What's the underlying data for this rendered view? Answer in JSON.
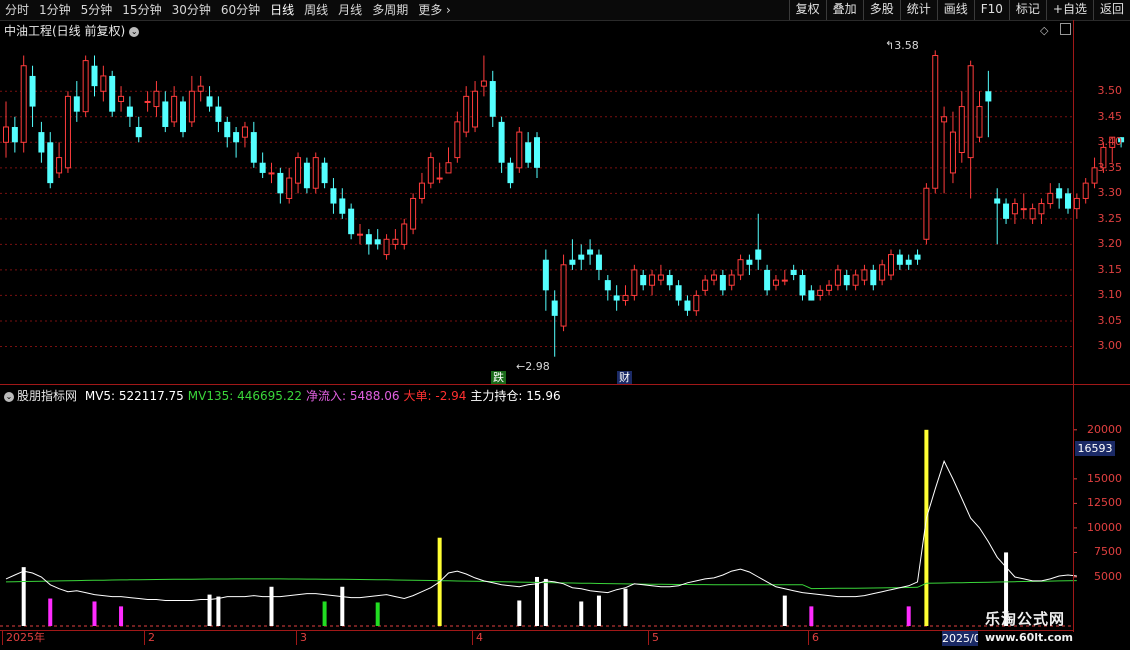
{
  "toolbar": {
    "period_tabs": [
      "分时",
      "1分钟",
      "5分钟",
      "15分钟",
      "30分钟",
      "60分钟",
      "日线",
      "周线",
      "月线",
      "多周期",
      "更多"
    ],
    "active_tab": "日线",
    "right_tools": [
      "复权",
      "叠加",
      "多股",
      "统计",
      "画线",
      "F10",
      "标记",
      "+自选",
      "返回"
    ]
  },
  "main_chart": {
    "title": "中油工程(日线 前复权)",
    "high_label": "3.58",
    "low_label": "2.98",
    "markers": {
      "die": "跌",
      "cai": "财"
    },
    "price_axis": [
      "3.50",
      "3.45",
      "3.40",
      "3.35",
      "3.30",
      "3.25",
      "3.20",
      "3.15",
      "3.10",
      "3.05",
      "3.00"
    ]
  },
  "indicator": {
    "name": "股朋指标网",
    "fields": [
      {
        "label": "MV5",
        "value": "522117.75",
        "color": "#ffffff"
      },
      {
        "label": "MV135",
        "value": "446695.22",
        "color": "#3ad53a"
      },
      {
        "label": "净流入",
        "value": "5488.06",
        "color": "#e060e0"
      },
      {
        "label": "大单",
        "value": "-2.94",
        "color": "#ff3030"
      },
      {
        "label": "主力持仓",
        "value": "15.96",
        "color": "#ffffff"
      }
    ],
    "axis": [
      "20000",
      "15000",
      "12500",
      "10000",
      "7500",
      "5000"
    ],
    "current_value": "16593"
  },
  "time_axis": {
    "labels": [
      "2025年",
      "2",
      "3",
      "4",
      "5",
      "6"
    ],
    "current_date": "2025/0"
  },
  "watermark": {
    "title": "乐淘公式网",
    "url": "www.60lt.com"
  },
  "colors": {
    "up": "#ff3c3c",
    "down": "#54ffff",
    "axis": "#e04040",
    "grid": "#7a1010"
  },
  "chart_data": {
    "type": "candlestick",
    "price_range": [
      2.95,
      3.62
    ],
    "candles": [
      {
        "o": 3.4,
        "c": 3.43,
        "h": 3.48,
        "l": 3.37
      },
      {
        "o": 3.43,
        "c": 3.4,
        "h": 3.45,
        "l": 3.38
      },
      {
        "o": 3.4,
        "c": 3.55,
        "h": 3.57,
        "l": 3.38
      },
      {
        "o": 3.53,
        "c": 3.47,
        "h": 3.55,
        "l": 3.43
      },
      {
        "o": 3.42,
        "c": 3.38,
        "h": 3.44,
        "l": 3.36
      },
      {
        "o": 3.4,
        "c": 3.32,
        "h": 3.42,
        "l": 3.31
      },
      {
        "o": 3.34,
        "c": 3.37,
        "h": 3.4,
        "l": 3.33
      },
      {
        "o": 3.35,
        "c": 3.49,
        "h": 3.5,
        "l": 3.34
      },
      {
        "o": 3.49,
        "c": 3.46,
        "h": 3.52,
        "l": 3.44
      },
      {
        "o": 3.46,
        "c": 3.56,
        "h": 3.57,
        "l": 3.45
      },
      {
        "o": 3.55,
        "c": 3.51,
        "h": 3.57,
        "l": 3.49
      },
      {
        "o": 3.5,
        "c": 3.53,
        "h": 3.55,
        "l": 3.48
      },
      {
        "o": 3.53,
        "c": 3.46,
        "h": 3.54,
        "l": 3.45
      },
      {
        "o": 3.48,
        "c": 3.49,
        "h": 3.51,
        "l": 3.46
      },
      {
        "o": 3.47,
        "c": 3.45,
        "h": 3.49,
        "l": 3.43
      },
      {
        "o": 3.43,
        "c": 3.41,
        "h": 3.45,
        "l": 3.4
      },
      {
        "o": 3.48,
        "c": 3.48,
        "h": 3.5,
        "l": 3.46
      },
      {
        "o": 3.47,
        "c": 3.5,
        "h": 3.52,
        "l": 3.45
      },
      {
        "o": 3.48,
        "c": 3.43,
        "h": 3.5,
        "l": 3.42
      },
      {
        "o": 3.44,
        "c": 3.49,
        "h": 3.51,
        "l": 3.43
      },
      {
        "o": 3.48,
        "c": 3.42,
        "h": 3.49,
        "l": 3.41
      },
      {
        "o": 3.44,
        "c": 3.5,
        "h": 3.53,
        "l": 3.43
      },
      {
        "o": 3.5,
        "c": 3.51,
        "h": 3.53,
        "l": 3.48
      },
      {
        "o": 3.49,
        "c": 3.47,
        "h": 3.51,
        "l": 3.46
      },
      {
        "o": 3.47,
        "c": 3.44,
        "h": 3.49,
        "l": 3.42
      },
      {
        "o": 3.44,
        "c": 3.41,
        "h": 3.45,
        "l": 3.39
      },
      {
        "o": 3.42,
        "c": 3.4,
        "h": 3.43,
        "l": 3.37
      },
      {
        "o": 3.41,
        "c": 3.43,
        "h": 3.44,
        "l": 3.39
      },
      {
        "o": 3.42,
        "c": 3.36,
        "h": 3.44,
        "l": 3.35
      },
      {
        "o": 3.36,
        "c": 3.34,
        "h": 3.38,
        "l": 3.33
      },
      {
        "o": 3.34,
        "c": 3.34,
        "h": 3.36,
        "l": 3.32
      },
      {
        "o": 3.34,
        "c": 3.3,
        "h": 3.35,
        "l": 3.28
      },
      {
        "o": 3.29,
        "c": 3.33,
        "h": 3.35,
        "l": 3.28
      },
      {
        "o": 3.32,
        "c": 3.37,
        "h": 3.38,
        "l": 3.3
      },
      {
        "o": 3.36,
        "c": 3.31,
        "h": 3.37,
        "l": 3.3
      },
      {
        "o": 3.31,
        "c": 3.37,
        "h": 3.38,
        "l": 3.3
      },
      {
        "o": 3.36,
        "c": 3.32,
        "h": 3.37,
        "l": 3.31
      },
      {
        "o": 3.31,
        "c": 3.28,
        "h": 3.33,
        "l": 3.26
      },
      {
        "o": 3.29,
        "c": 3.26,
        "h": 3.31,
        "l": 3.25
      },
      {
        "o": 3.27,
        "c": 3.22,
        "h": 3.28,
        "l": 3.21
      },
      {
        "o": 3.22,
        "c": 3.22,
        "h": 3.24,
        "l": 3.2
      },
      {
        "o": 3.22,
        "c": 3.2,
        "h": 3.23,
        "l": 3.18
      },
      {
        "o": 3.21,
        "c": 3.2,
        "h": 3.23,
        "l": 3.19
      },
      {
        "o": 3.18,
        "c": 3.21,
        "h": 3.22,
        "l": 3.17
      },
      {
        "o": 3.2,
        "c": 3.21,
        "h": 3.23,
        "l": 3.19
      },
      {
        "o": 3.2,
        "c": 3.24,
        "h": 3.25,
        "l": 3.19
      },
      {
        "o": 3.23,
        "c": 3.29,
        "h": 3.3,
        "l": 3.22
      },
      {
        "o": 3.29,
        "c": 3.32,
        "h": 3.34,
        "l": 3.28
      },
      {
        "o": 3.32,
        "c": 3.37,
        "h": 3.38,
        "l": 3.31
      },
      {
        "o": 3.33,
        "c": 3.33,
        "h": 3.36,
        "l": 3.32
      },
      {
        "o": 3.34,
        "c": 3.36,
        "h": 3.39,
        "l": 3.34
      },
      {
        "o": 3.37,
        "c": 3.44,
        "h": 3.46,
        "l": 3.36
      },
      {
        "o": 3.42,
        "c": 3.49,
        "h": 3.51,
        "l": 3.41
      },
      {
        "o": 3.43,
        "c": 3.5,
        "h": 3.52,
        "l": 3.42
      },
      {
        "o": 3.51,
        "c": 3.52,
        "h": 3.57,
        "l": 3.49
      },
      {
        "o": 3.52,
        "c": 3.45,
        "h": 3.54,
        "l": 3.43
      },
      {
        "o": 3.44,
        "c": 3.36,
        "h": 3.45,
        "l": 3.34
      },
      {
        "o": 3.36,
        "c": 3.32,
        "h": 3.37,
        "l": 3.31
      },
      {
        "o": 3.35,
        "c": 3.42,
        "h": 3.43,
        "l": 3.34
      },
      {
        "o": 3.4,
        "c": 3.36,
        "h": 3.42,
        "l": 3.35
      },
      {
        "o": 3.41,
        "c": 3.35,
        "h": 3.42,
        "l": 3.33
      },
      {
        "o": 3.17,
        "c": 3.11,
        "h": 3.19,
        "l": 3.07
      },
      {
        "o": 3.09,
        "c": 3.06,
        "h": 3.11,
        "l": 2.98
      },
      {
        "o": 3.04,
        "c": 3.16,
        "h": 3.18,
        "l": 3.03
      },
      {
        "o": 3.17,
        "c": 3.16,
        "h": 3.21,
        "l": 3.15
      },
      {
        "o": 3.18,
        "c": 3.17,
        "h": 3.2,
        "l": 3.15
      },
      {
        "o": 3.19,
        "c": 3.18,
        "h": 3.21,
        "l": 3.16
      },
      {
        "o": 3.18,
        "c": 3.15,
        "h": 3.19,
        "l": 3.13
      },
      {
        "o": 3.13,
        "c": 3.11,
        "h": 3.14,
        "l": 3.09
      },
      {
        "o": 3.1,
        "c": 3.09,
        "h": 3.12,
        "l": 3.07
      },
      {
        "o": 3.09,
        "c": 3.1,
        "h": 3.12,
        "l": 3.08
      },
      {
        "o": 3.1,
        "c": 3.15,
        "h": 3.16,
        "l": 3.09
      },
      {
        "o": 3.14,
        "c": 3.12,
        "h": 3.15,
        "l": 3.11
      },
      {
        "o": 3.12,
        "c": 3.14,
        "h": 3.15,
        "l": 3.1
      },
      {
        "o": 3.13,
        "c": 3.14,
        "h": 3.16,
        "l": 3.12
      },
      {
        "o": 3.14,
        "c": 3.12,
        "h": 3.15,
        "l": 3.11
      },
      {
        "o": 3.12,
        "c": 3.09,
        "h": 3.13,
        "l": 3.08
      },
      {
        "o": 3.09,
        "c": 3.07,
        "h": 3.1,
        "l": 3.06
      },
      {
        "o": 3.07,
        "c": 3.1,
        "h": 3.11,
        "l": 3.06
      },
      {
        "o": 3.11,
        "c": 3.13,
        "h": 3.14,
        "l": 3.1
      },
      {
        "o": 3.13,
        "c": 3.14,
        "h": 3.15,
        "l": 3.12
      },
      {
        "o": 3.14,
        "c": 3.11,
        "h": 3.15,
        "l": 3.1
      },
      {
        "o": 3.12,
        "c": 3.14,
        "h": 3.15,
        "l": 3.11
      },
      {
        "o": 3.14,
        "c": 3.17,
        "h": 3.18,
        "l": 3.13
      },
      {
        "o": 3.17,
        "c": 3.16,
        "h": 3.18,
        "l": 3.14
      },
      {
        "o": 3.19,
        "c": 3.17,
        "h": 3.26,
        "l": 3.15
      },
      {
        "o": 3.15,
        "c": 3.11,
        "h": 3.16,
        "l": 3.1
      },
      {
        "o": 3.12,
        "c": 3.13,
        "h": 3.14,
        "l": 3.11
      },
      {
        "o": 3.13,
        "c": 3.13,
        "h": 3.15,
        "l": 3.12
      },
      {
        "o": 3.15,
        "c": 3.14,
        "h": 3.16,
        "l": 3.13
      },
      {
        "o": 3.14,
        "c": 3.1,
        "h": 3.15,
        "l": 3.09
      },
      {
        "o": 3.11,
        "c": 3.09,
        "h": 3.12,
        "l": 3.09
      },
      {
        "o": 3.1,
        "c": 3.11,
        "h": 3.12,
        "l": 3.09
      },
      {
        "o": 3.11,
        "c": 3.12,
        "h": 3.13,
        "l": 3.1
      },
      {
        "o": 3.12,
        "c": 3.15,
        "h": 3.16,
        "l": 3.11
      },
      {
        "o": 3.14,
        "c": 3.12,
        "h": 3.15,
        "l": 3.11
      },
      {
        "o": 3.12,
        "c": 3.14,
        "h": 3.15,
        "l": 3.11
      },
      {
        "o": 3.13,
        "c": 3.15,
        "h": 3.16,
        "l": 3.12
      },
      {
        "o": 3.15,
        "c": 3.12,
        "h": 3.16,
        "l": 3.11
      },
      {
        "o": 3.13,
        "c": 3.16,
        "h": 3.17,
        "l": 3.12
      },
      {
        "o": 3.14,
        "c": 3.18,
        "h": 3.19,
        "l": 3.13
      },
      {
        "o": 3.18,
        "c": 3.16,
        "h": 3.19,
        "l": 3.15
      },
      {
        "o": 3.17,
        "c": 3.16,
        "h": 3.18,
        "l": 3.15
      },
      {
        "o": 3.18,
        "c": 3.17,
        "h": 3.19,
        "l": 3.16
      },
      {
        "o": 3.21,
        "c": 3.31,
        "h": 3.32,
        "l": 3.2
      },
      {
        "o": 3.31,
        "c": 3.57,
        "h": 3.58,
        "l": 3.3
      },
      {
        "o": 3.44,
        "c": 3.45,
        "h": 3.47,
        "l": 3.3
      },
      {
        "o": 3.34,
        "c": 3.42,
        "h": 3.46,
        "l": 3.32
      },
      {
        "o": 3.38,
        "c": 3.47,
        "h": 3.5,
        "l": 3.36
      },
      {
        "o": 3.37,
        "c": 3.55,
        "h": 3.56,
        "l": 3.29
      },
      {
        "o": 3.41,
        "c": 3.47,
        "h": 3.5,
        "l": 3.4
      },
      {
        "o": 3.5,
        "c": 3.48,
        "h": 3.54,
        "l": 3.41
      },
      {
        "o": 3.29,
        "c": 3.28,
        "h": 3.31,
        "l": 3.2
      },
      {
        "o": 3.28,
        "c": 3.25,
        "h": 3.29,
        "l": 3.24
      },
      {
        "o": 3.26,
        "c": 3.28,
        "h": 3.29,
        "l": 3.24
      },
      {
        "o": 3.27,
        "c": 3.27,
        "h": 3.3,
        "l": 3.25
      },
      {
        "o": 3.25,
        "c": 3.27,
        "h": 3.28,
        "l": 3.24
      },
      {
        "o": 3.26,
        "c": 3.28,
        "h": 3.29,
        "l": 3.24
      },
      {
        "o": 3.28,
        "c": 3.3,
        "h": 3.32,
        "l": 3.27
      },
      {
        "o": 3.31,
        "c": 3.29,
        "h": 3.32,
        "l": 3.27
      },
      {
        "o": 3.3,
        "c": 3.27,
        "h": 3.31,
        "l": 3.26
      },
      {
        "o": 3.27,
        "c": 3.29,
        "h": 3.3,
        "l": 3.25
      },
      {
        "o": 3.29,
        "c": 3.32,
        "h": 3.33,
        "l": 3.28
      },
      {
        "o": 3.32,
        "c": 3.35,
        "h": 3.37,
        "l": 3.31
      },
      {
        "o": 3.35,
        "c": 3.39,
        "h": 3.4,
        "l": 3.34
      },
      {
        "o": 3.39,
        "c": 3.41,
        "h": 3.41,
        "l": 3.36
      },
      {
        "o": 3.41,
        "c": 3.4,
        "h": 3.41,
        "l": 3.39
      }
    ],
    "indicator_range": [
      0,
      21000
    ],
    "bars": [
      {
        "i": 2,
        "v": 6000,
        "c": "w"
      },
      {
        "i": 5,
        "v": 2800,
        "c": "m"
      },
      {
        "i": 10,
        "v": 2500,
        "c": "m"
      },
      {
        "i": 13,
        "v": 2000,
        "c": "m"
      },
      {
        "i": 23,
        "v": 3200,
        "c": "w"
      },
      {
        "i": 24,
        "v": 3000,
        "c": "w"
      },
      {
        "i": 30,
        "v": 4000,
        "c": "w"
      },
      {
        "i": 36,
        "v": 2500,
        "c": "g"
      },
      {
        "i": 38,
        "v": 4000,
        "c": "w"
      },
      {
        "i": 42,
        "v": 2400,
        "c": "g"
      },
      {
        "i": 49,
        "v": 9000,
        "c": "y"
      },
      {
        "i": 58,
        "v": 2600,
        "c": "w"
      },
      {
        "i": 60,
        "v": 5000,
        "c": "w"
      },
      {
        "i": 61,
        "v": 4800,
        "c": "w"
      },
      {
        "i": 65,
        "v": 2500,
        "c": "w"
      },
      {
        "i": 67,
        "v": 3100,
        "c": "w"
      },
      {
        "i": 70,
        "v": 3800,
        "c": "w"
      },
      {
        "i": 88,
        "v": 3100,
        "c": "w"
      },
      {
        "i": 91,
        "v": 2000,
        "c": "m"
      },
      {
        "i": 102,
        "v": 2000,
        "c": "m"
      },
      {
        "i": 104,
        "v": 20000,
        "c": "y"
      },
      {
        "i": 113,
        "v": 7500,
        "c": "w"
      }
    ],
    "mv5": [
      4800,
      5200,
      5600,
      5400,
      5000,
      4200,
      3800,
      3500,
      3600,
      3400,
      3200,
      3100,
      3000,
      3000,
      2900,
      2800,
      2700,
      2700,
      2600,
      2600,
      2600,
      2600,
      2700,
      2700,
      2800,
      3000,
      3000,
      3000,
      3100,
      3000,
      3000,
      3000,
      3100,
      3200,
      3300,
      3300,
      3200,
      3100,
      3000,
      2900,
      2900,
      3000,
      3100,
      3200,
      3000,
      2800,
      3100,
      3500,
      3900,
      4500,
      5400,
      5600,
      5300,
      4900,
      4600,
      4400,
      4200,
      4100,
      4000,
      4200,
      4300,
      4600,
      4500,
      4300,
      3900,
      3800,
      3600,
      3500,
      3400,
      3700,
      3900,
      4300,
      4200,
      4100,
      4000,
      4000,
      4100,
      4400,
      4600,
      4800,
      4900,
      5200,
      5600,
      5800,
      5500,
      5000,
      4500,
      4000,
      3800,
      3600,
      3400,
      3300,
      3200,
      3100,
      3000,
      3000,
      3000,
      3100,
      3300,
      3500,
      3700,
      3900,
      4100,
      4500,
      11000,
      14000,
      16800,
      15000,
      13000,
      11000,
      10000,
      8600,
      7000,
      6000,
      5000,
      4800,
      4600,
      4600,
      4800,
      5100,
      5200,
      5100
    ]
  }
}
